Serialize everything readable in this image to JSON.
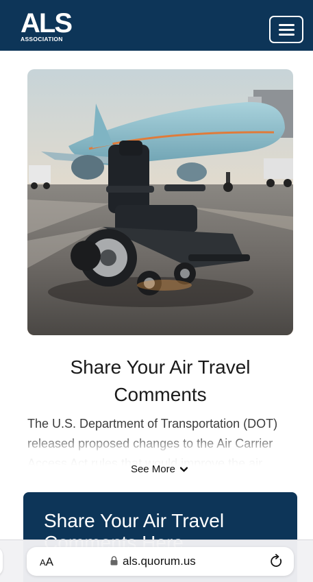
{
  "header": {
    "logo_main": "ALS",
    "logo_sub": "ASSOCIATION",
    "menu_icon": "hamburger-menu-icon"
  },
  "hero": {
    "image_subject": "power wheelchair on airport tarmac in front of a passenger jet"
  },
  "article": {
    "title": "Share Your Air Travel Comments",
    "body": "The U.S. Department of Transportation (DOT) released proposed changes to the Air Carrier Access Act rules that would improve the air",
    "see_more_label": "See More",
    "see_more_icon": "chevron-down-icon"
  },
  "card": {
    "title": "Share Your Air Travel Comments Here"
  },
  "browser": {
    "aa_small": "A",
    "aa_big": "A",
    "url": "als.quorum.us",
    "lock_icon": "lock-icon",
    "reload_icon": "reload-icon"
  },
  "colors": {
    "brand_navy": "#0d3558",
    "text_dark": "#1a1a1a",
    "body_text": "#3c3c3c"
  }
}
